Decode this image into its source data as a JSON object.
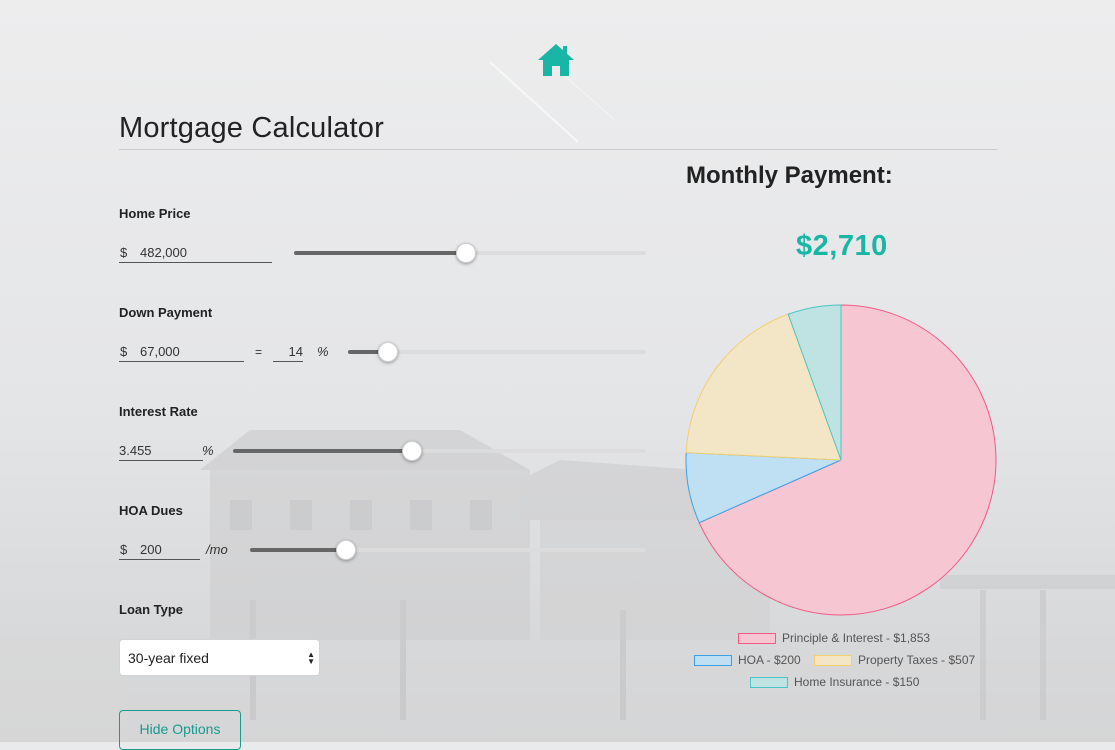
{
  "header": {
    "title": "Mortgage Calculator"
  },
  "inputs": {
    "home_price": {
      "label": "Home Price",
      "currency": "$",
      "value": "482,000",
      "slider_fraction": 0.485
    },
    "down_payment": {
      "label": "Down Payment",
      "currency": "$",
      "value": "67,000",
      "equals": "=",
      "percent_value": "14",
      "percent_symbol": "%",
      "slider_fraction": 0.13
    },
    "interest_rate": {
      "label": "Interest Rate",
      "value": "3.455",
      "percent_symbol": "%",
      "slider_fraction": 0.43
    },
    "hoa_dues": {
      "label": "HOA Dues",
      "currency": "$",
      "value": "200",
      "unit": "/mo",
      "slider_fraction": 0.24
    },
    "loan_type": {
      "label": "Loan Type",
      "selected": "30-year fixed"
    }
  },
  "buttons": {
    "hide_options": "Hide Options"
  },
  "summary": {
    "label": "Monthly Payment:",
    "amount": "$2,710"
  },
  "icons": {
    "home": "home-icon",
    "select_arrows": "select-arrows-icon"
  },
  "colors": {
    "accent": "#19b6a5"
  },
  "chart_data": {
    "type": "pie",
    "title": "",
    "slices": [
      {
        "label": "Principle & Interest - $1,853",
        "value": 1853,
        "fill": "#f6c6d2",
        "stroke": "#ef5b86"
      },
      {
        "label": "HOA - $200",
        "value": 200,
        "fill": "#bfdff2",
        "stroke": "#3fa0e4"
      },
      {
        "label": "Property Taxes - $507",
        "value": 507,
        "fill": "#f3e6c6",
        "stroke": "#f2cf6f"
      },
      {
        "label": "Home Insurance - $150",
        "value": 150,
        "fill": "#bfe3e2",
        "stroke": "#4cc4c4"
      }
    ],
    "legend_position": "bottom"
  }
}
